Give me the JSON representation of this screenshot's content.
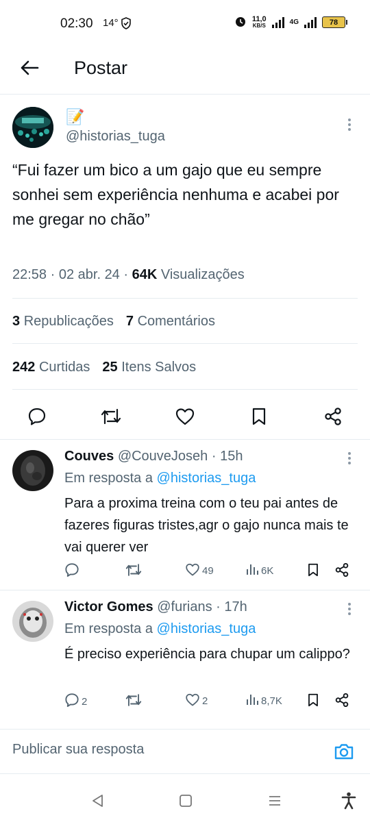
{
  "status_bar": {
    "time": "02:30",
    "temp": "14°",
    "speed_value": "11,0",
    "speed_unit": "KB/S",
    "network": "4G",
    "battery": "78"
  },
  "header": {
    "title": "Postar"
  },
  "post": {
    "emoji": "📝",
    "handle": "@historias_tuga",
    "text": "“Fui fazer um bico a um gajo que eu sempre sonhei sem experiência nenhuma e acabei por me gregar no chão”",
    "time": "22:58",
    "date": "02 abr. 24",
    "views_count": "64K",
    "views_label": "Visualizações",
    "reposts_count": "3",
    "reposts_label": "Republicações",
    "comments_count": "7",
    "comments_label": "Comentários",
    "likes_count": "242",
    "likes_label": "Curtidas",
    "saves_count": "25",
    "saves_label": "Itens Salvos"
  },
  "replies": [
    {
      "name": "Couves",
      "handle": "@CouveJoseh",
      "time": "15h",
      "reply_to_prefix": "Em resposta a",
      "reply_to": "@historias_tuga",
      "text": "Para a proxima treina com o teu pai antes de fazeres figuras tristes,agr o gajo nunca mais te vai querer ver",
      "comments": "",
      "reposts": "",
      "likes": "49",
      "views": "6K"
    },
    {
      "name": "Victor Gomes",
      "handle": "@furians",
      "time": "17h",
      "reply_to_prefix": "Em resposta a",
      "reply_to": "@historias_tuga",
      "text": "É preciso experiência para chupar um calippo?",
      "comments": "2",
      "reposts": "",
      "likes": "2",
      "views": "8,7K"
    }
  ],
  "composer": {
    "placeholder": "Publicar sua resposta"
  },
  "colors": {
    "accent": "#1d9bf0",
    "secondary_text": "#536471",
    "divider": "#e6ecf0"
  }
}
